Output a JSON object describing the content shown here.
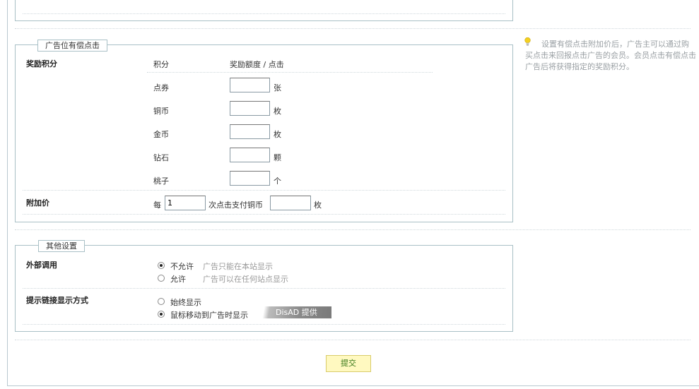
{
  "paid_click": {
    "legend": "广告位有偿点击",
    "reward_label": "奖励积分",
    "header_col1": "积分",
    "header_col2": "奖励额度 / 点击",
    "items": [
      {
        "name": "点券",
        "value": "",
        "unit": "张"
      },
      {
        "name": "铜币",
        "value": "",
        "unit": "枚"
      },
      {
        "name": "金币",
        "value": "",
        "unit": "枚"
      },
      {
        "name": "钻石",
        "value": "",
        "unit": "颗"
      },
      {
        "name": "桃子",
        "value": "",
        "unit": "个"
      }
    ],
    "surcharge_label": "附加价",
    "surcharge_prefix": "每",
    "surcharge_clicks": "1",
    "surcharge_mid": "次点击支付铜币",
    "surcharge_amount": "",
    "surcharge_unit": "枚"
  },
  "hint": {
    "text": "设置有偿点击附加价后，广告主可以通过购买点击来回报点击广告的会员。会员点击有偿点击广告后将获得指定的奖励积分。"
  },
  "other": {
    "legend": "其他设置",
    "external_label": "外部调用",
    "external_options": [
      {
        "label": "不允许",
        "desc": "广告只能在本站显示",
        "checked": true
      },
      {
        "label": "允许",
        "desc": "广告可以在任何站点显示",
        "checked": false
      }
    ],
    "link_label": "提示链接显示方式",
    "link_options": [
      {
        "label": "始终显示",
        "checked": false
      },
      {
        "label": "鼠标移动到广告时显示",
        "checked": true
      }
    ],
    "disad_badge": "DisAD 提供"
  },
  "submit_label": "提交"
}
